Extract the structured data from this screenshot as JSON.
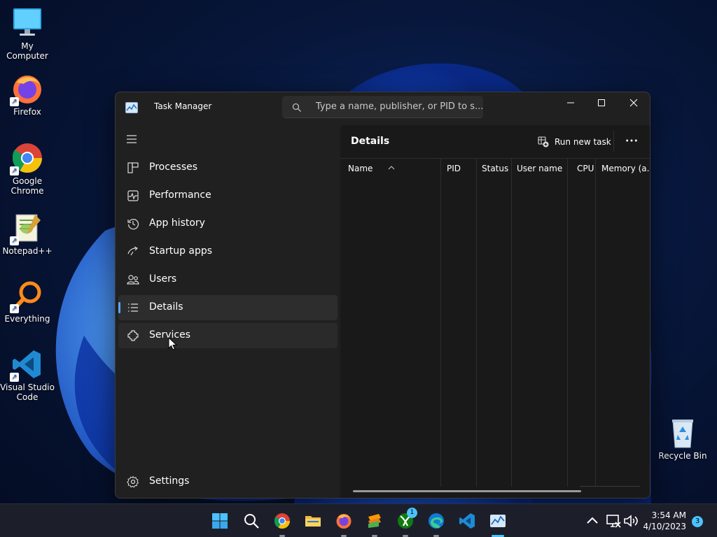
{
  "desktop": {
    "icons": [
      {
        "label": "My Computer",
        "icon": "monitor-icon"
      },
      {
        "label": "Firefox",
        "icon": "firefox-icon"
      },
      {
        "label": "Google Chrome",
        "icon": "chrome-icon"
      },
      {
        "label": "Notepad++",
        "icon": "notepadpp-icon"
      },
      {
        "label": "Everything",
        "icon": "everything-icon"
      },
      {
        "label": "Visual Studio Code",
        "icon": "vscode-icon"
      },
      {
        "label": "Recycle Bin",
        "icon": "recycle-bin-icon"
      }
    ]
  },
  "window": {
    "title": "Task Manager",
    "search_placeholder": "Type a name, publisher, or PID to s...",
    "controls": [
      "minimize",
      "maximize",
      "close"
    ]
  },
  "sidebar": {
    "items": [
      {
        "label": "Processes",
        "icon": "processes-icon"
      },
      {
        "label": "Performance",
        "icon": "performance-icon"
      },
      {
        "label": "App history",
        "icon": "app-history-icon"
      },
      {
        "label": "Startup apps",
        "icon": "startup-apps-icon"
      },
      {
        "label": "Users",
        "icon": "users-icon"
      },
      {
        "label": "Details",
        "icon": "details-icon",
        "active": true
      },
      {
        "label": "Services",
        "icon": "services-icon",
        "hover": true
      }
    ],
    "settings_label": "Settings"
  },
  "details": {
    "title": "Details",
    "run_new_task_label": "Run new task",
    "columns": [
      "Name",
      "PID",
      "Status",
      "User name",
      "CPU",
      "Memory (a..."
    ]
  },
  "taskbar": {
    "apps": [
      "start",
      "search",
      "chrome",
      "file-explorer",
      "firefox",
      "sublime",
      "xbox",
      "edge",
      "vscode",
      "task-manager"
    ],
    "xbox_badge": "1",
    "time": "3:54 AM",
    "date": "4/10/2023",
    "notification_count": "3"
  },
  "colors": {
    "accent": "#5aa8ff",
    "window_bg": "#202020",
    "content_bg": "#191919",
    "taskbar_bg": "#1c1f2a"
  }
}
